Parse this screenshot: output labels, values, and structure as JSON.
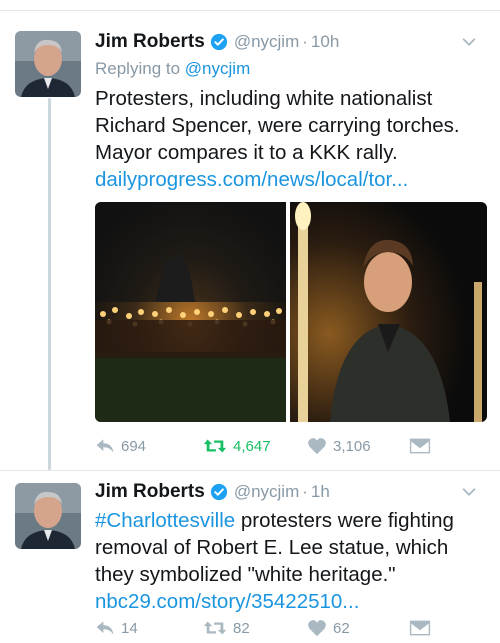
{
  "tweets": [
    {
      "name": "Jim Roberts",
      "handle": "@nycjim",
      "separator": "·",
      "time": "10h",
      "replying_label": "Replying to",
      "replying_to": "@nycjim",
      "text_lines": [
        "Protesters, including white nationalist",
        "Richard Spencer, were carrying torches.",
        "Mayor compares it to a KKK rally."
      ],
      "link": "dailyprogress.com/news/local/tor...",
      "actions": {
        "replies": "694",
        "retweets": "4,647",
        "likes": "3,106"
      }
    },
    {
      "name": "Jim Roberts",
      "handle": "@nycjim",
      "separator": "·",
      "time": "1h",
      "hashtag": "#Charlottesville",
      "text_first_rest": " protesters were fighting",
      "text_lines": [
        "removal of Robert E. Lee statue, which",
        "they symbolized \"white heritage.\""
      ],
      "link": "nbc29.com/story/35422510...",
      "actions": {
        "replies": "14",
        "retweets": "82",
        "likes": "62"
      }
    }
  ],
  "colors": {
    "link": "#1b95e0",
    "retweet_active": "#17bf63",
    "muted": "#8899a6",
    "verified": "#1da1f2"
  },
  "icons": [
    "verified-badge-icon",
    "chevron-down-icon",
    "reply-icon",
    "retweet-icon",
    "heart-icon",
    "direct-message-icon"
  ]
}
